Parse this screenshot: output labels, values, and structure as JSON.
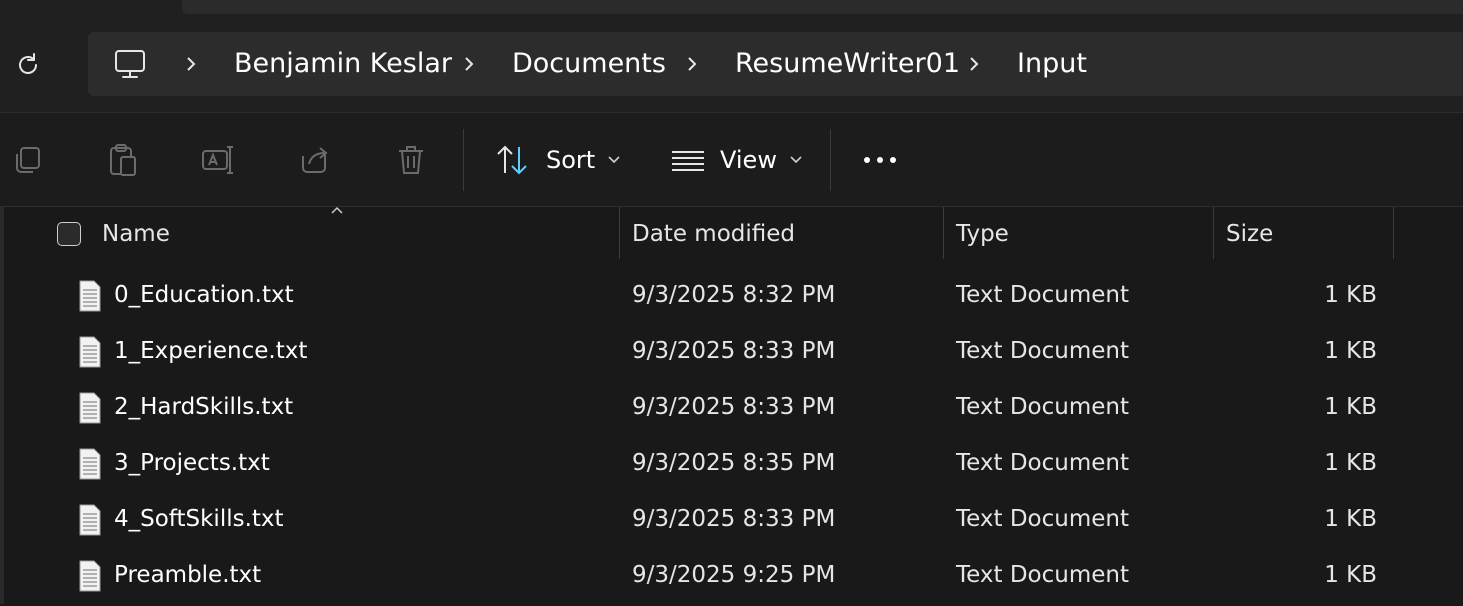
{
  "breadcrumb": {
    "root_icon": "computer-icon",
    "items": [
      "Benjamin Keslar",
      "Documents",
      "ResumeWriter01",
      "Input"
    ]
  },
  "toolbar": {
    "copy_icon": "copy-icon",
    "paste_icon": "paste-icon",
    "rename_icon": "rename-icon",
    "share_icon": "share-icon",
    "delete_icon": "delete-icon",
    "sort_label": "Sort",
    "view_label": "View",
    "more_icon": "more-icon"
  },
  "columns": {
    "name": "Name",
    "date": "Date modified",
    "type": "Type",
    "size": "Size"
  },
  "files": [
    {
      "name": "0_Education.txt",
      "date": "9/3/2025 8:32 PM",
      "type": "Text Document",
      "size": "1 KB"
    },
    {
      "name": "1_Experience.txt",
      "date": "9/3/2025 8:33 PM",
      "type": "Text Document",
      "size": "1 KB"
    },
    {
      "name": "2_HardSkills.txt",
      "date": "9/3/2025 8:33 PM",
      "type": "Text Document",
      "size": "1 KB"
    },
    {
      "name": "3_Projects.txt",
      "date": "9/3/2025 8:35 PM",
      "type": "Text Document",
      "size": "1 KB"
    },
    {
      "name": "4_SoftSkills.txt",
      "date": "9/3/2025 8:33 PM",
      "type": "Text Document",
      "size": "1 KB"
    },
    {
      "name": "Preamble.txt",
      "date": "9/3/2025 9:25 PM",
      "type": "Text Document",
      "size": "1 KB"
    }
  ],
  "colors": {
    "background": "#191919",
    "address_box": "#2c2c2c",
    "accent_sort": "#60cdff",
    "disabled_icon": "#6b6b6b"
  }
}
